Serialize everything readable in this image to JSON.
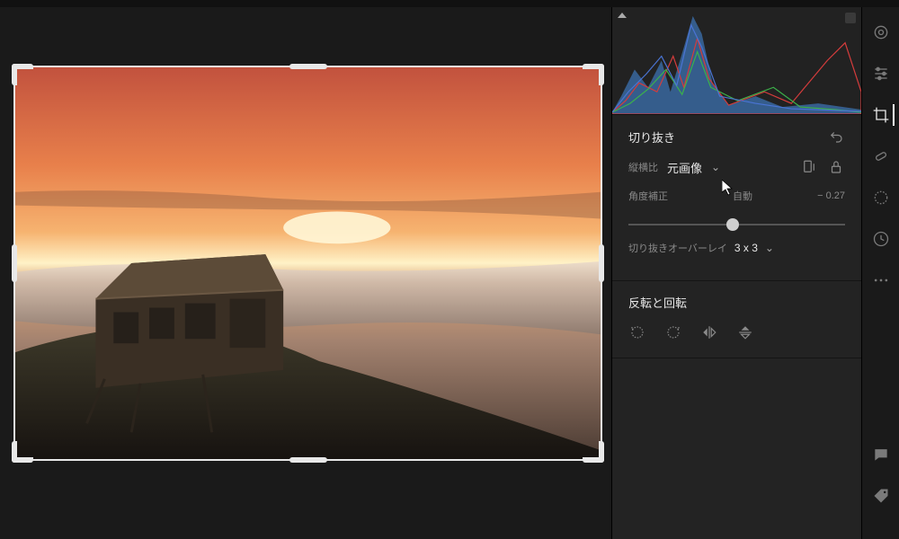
{
  "crop": {
    "title": "切り抜き",
    "aspect_label": "縦横比",
    "aspect_value": "元画像",
    "angle_label": "角度補正",
    "angle_auto": "自動",
    "angle_value": "− 0.27",
    "overlay_label": "切り抜きオーバーレイ",
    "overlay_value": "3 x 3"
  },
  "flip": {
    "title": "反転と回転"
  },
  "icons": {
    "undo": "undo",
    "rotate_aspect": "rotate-aspect",
    "lock": "lock",
    "rotate_ccw": "rotate-ccw",
    "rotate_cw": "rotate-cw",
    "flip_h": "flip-horizontal",
    "flip_v": "flip-vertical",
    "edit": "edit",
    "sliders": "sliders",
    "crop_tool": "crop",
    "heal": "heal",
    "radial": "radial",
    "history": "history",
    "more": "more",
    "comment": "comment",
    "tag": "tag"
  },
  "colors": {
    "accent": "#e8e8e8",
    "muted": "#8a8a8a"
  }
}
